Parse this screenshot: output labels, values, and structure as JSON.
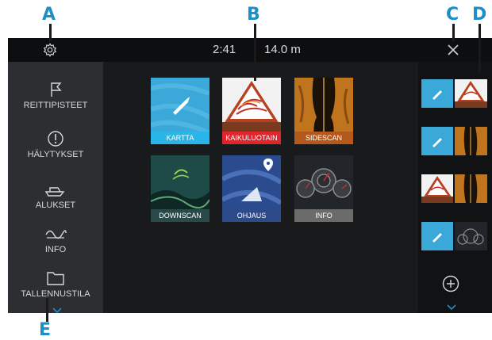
{
  "callouts": {
    "a": "A",
    "b": "B",
    "c": "C",
    "d": "D",
    "e": "E"
  },
  "status": {
    "time": "2:41",
    "depth": "14.0 m"
  },
  "sidebar": {
    "items": [
      {
        "label": "REITTIPISTEET",
        "icon": "flag-icon"
      },
      {
        "label": "HÄLYTYKSET",
        "icon": "alarm-icon"
      },
      {
        "label": "ALUKSET",
        "icon": "boat-icon"
      },
      {
        "label": "INFO",
        "icon": "wave-icon"
      },
      {
        "label": "TALLENNUSTILA",
        "icon": "folder-icon"
      }
    ]
  },
  "apps": [
    {
      "label": "KARTTA",
      "label_color": "#29b5e8"
    },
    {
      "label": "KAIKULUOTAIN",
      "label_color": "#e0262d"
    },
    {
      "label": "SIDESCAN",
      "label_color": "#b5581c"
    },
    {
      "label": "DOWNSCAN",
      "label_color": "#2a4a4a"
    },
    {
      "label": "OHJAUS",
      "label_color": "#2d4a8a"
    },
    {
      "label": "INFO",
      "label_color": "#6b6b6b"
    }
  ],
  "favorites": [
    "chart-sonar-favorite",
    "chart-sidescan-favorite",
    "sonar-sidescan-favorite",
    "chart-info-favorite"
  ],
  "icons": {
    "settings": "gear-icon",
    "close": "close-icon",
    "add": "plus-circle-icon",
    "scroll": "chevron-down-icon"
  },
  "colors": {
    "accent": "#1c8fc8",
    "topbar": "#0d0e10",
    "sidebar": "#2c2e31",
    "workspace": "#181a1c"
  }
}
